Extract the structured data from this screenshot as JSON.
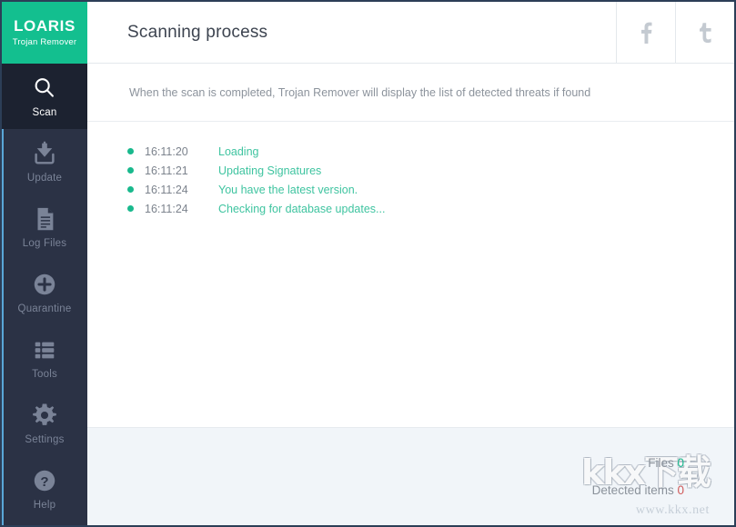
{
  "app": {
    "logo_title": "LOARIS",
    "logo_subtitle": "Trojan Remover",
    "accent_color": "#13bf8f",
    "sidebar_color": "#2b3245",
    "active_color": "#1c2230"
  },
  "sidebar": {
    "items": [
      {
        "label": "Scan",
        "icon": "search-icon",
        "active": true
      },
      {
        "label": "Update",
        "icon": "download-icon",
        "active": false
      },
      {
        "label": "Log Files",
        "icon": "document-icon",
        "active": false
      },
      {
        "label": "Quarantine",
        "icon": "plus-circle-icon",
        "active": false
      },
      {
        "label": "Tools",
        "icon": "list-icon",
        "active": false
      },
      {
        "label": "Settings",
        "icon": "gear-icon",
        "active": false
      },
      {
        "label": "Help",
        "icon": "question-circle-icon",
        "active": false
      }
    ]
  },
  "header": {
    "title": "Scanning process",
    "social": [
      {
        "name": "facebook-icon",
        "glyph": "f"
      },
      {
        "name": "twitter-icon",
        "glyph": "t"
      }
    ]
  },
  "notice": {
    "text": "When the scan is completed, Trojan Remover will display the list of detected threats if found"
  },
  "log": {
    "entries": [
      {
        "time": "16:11:20",
        "message": "Loading"
      },
      {
        "time": "16:11:21",
        "message": "Updating Signatures"
      },
      {
        "time": "16:11:24",
        "message": "You have the latest version."
      },
      {
        "time": "16:11:24",
        "message": "Checking for database updates..."
      }
    ]
  },
  "footer": {
    "files_label": "Files",
    "files_value": "0",
    "files_color": "#19b98d",
    "detected_label": "Detected items",
    "detected_value": "0",
    "detected_color": "#d05a5a",
    "watermark": "kkx下载",
    "watermark_url": "www.kkx.net"
  }
}
